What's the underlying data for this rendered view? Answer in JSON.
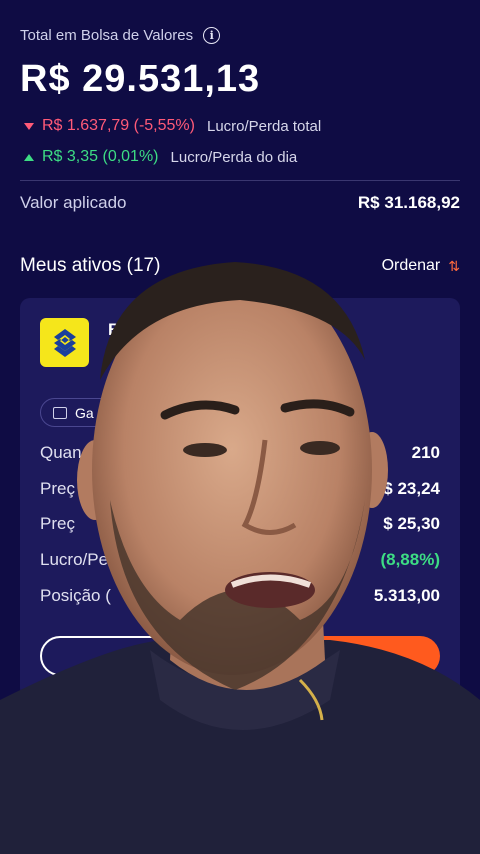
{
  "summary": {
    "total_label": "Total em Bolsa de Valores",
    "total_value": "R$ 29.531,13",
    "total_change": "R$ 1.637,79 (-5,55%)",
    "total_change_label": "Lucro/Perda total",
    "day_change": "R$ 3,35 (0,01%)",
    "day_change_label": "Lucro/Perda do dia",
    "applied_label": "Valor aplicado",
    "applied_value": "R$ 31.168,92"
  },
  "assets": {
    "title": "Meus ativos (17)",
    "sort_label": "Ordenar",
    "card": {
      "ticker": "BB",
      "tag": "Ga",
      "metrics": [
        {
          "label": "Quan",
          "value": "210"
        },
        {
          "label": "Preç",
          "value": "$ 23,24"
        },
        {
          "label": "Preç",
          "value": "$ 25,30"
        },
        {
          "label": "Lucro/Pe",
          "value": "(8,88%)"
        },
        {
          "label": "Posição (",
          "value": "5.313,00"
        }
      ],
      "trade_button": "gociar"
    }
  },
  "colors": {
    "background": "#0f0c44",
    "card": "#1d1a5c",
    "negative": "#ff5a78",
    "positive": "#3ddc84",
    "accent": "#ff5a1e",
    "bb_yellow": "#f5e61b"
  }
}
